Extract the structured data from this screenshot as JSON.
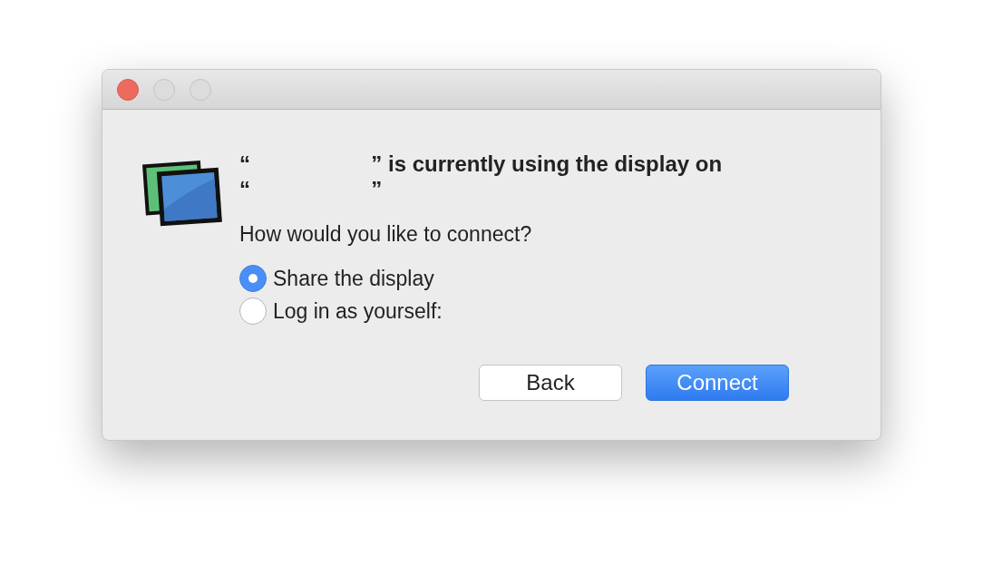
{
  "window": {
    "buttons": [
      {
        "kind": "close"
      },
      {
        "kind": "minimize"
      },
      {
        "kind": "zoom"
      }
    ]
  },
  "heading_lines": [
    "“                    ” is currently using the display on",
    "“                    ”"
  ],
  "question": "How would you like to connect?",
  "options": [
    {
      "label": "Share the display",
      "selected": true
    },
    {
      "label": "Log in as yourself:",
      "selected": false
    }
  ],
  "buttons": [
    {
      "label": "Back",
      "kind": "secondary"
    },
    {
      "label": "Connect",
      "kind": "primary"
    }
  ]
}
